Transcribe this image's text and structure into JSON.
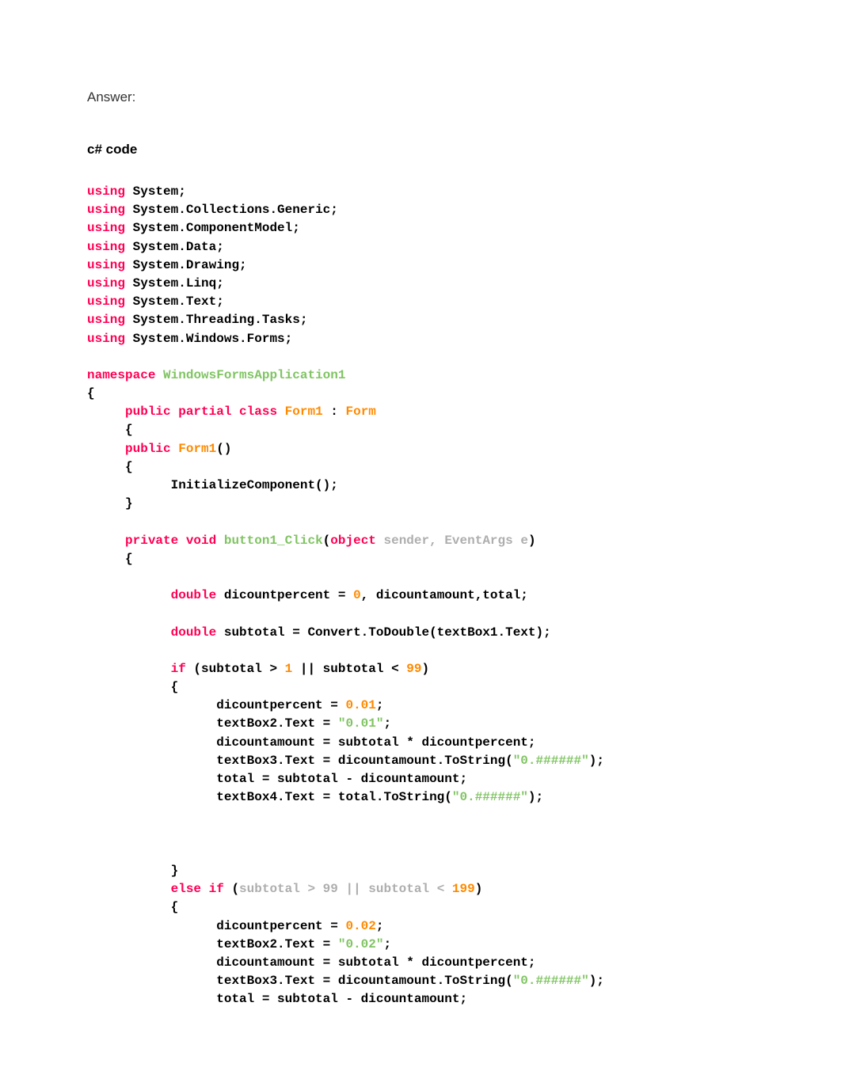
{
  "headings": {
    "answer": "Answer:",
    "section": "c# code"
  },
  "code": {
    "usings": [
      "System",
      "System.Collections.Generic",
      "System.ComponentModel",
      "System.Data",
      "System.Drawing",
      "System.Linq",
      "System.Text",
      "System.Threading.Tasks",
      "System.Windows.Forms"
    ],
    "namespace": "WindowsFormsApplication1",
    "class_name": "Form1",
    "base_class": "Form",
    "ctor": {
      "body": "InitializeComponent();"
    },
    "handler": {
      "name": "button1_Click",
      "params_grey": "sender, EventArgs e",
      "line_decl1_pre": "double dicountpercent = ",
      "line_decl1_zero": "0",
      "line_decl1_post": ", dicountamount,total;",
      "line_subtotal": "double subtotal = Convert.ToDouble(textBox1.Text);",
      "if_cond_pre": "if (subtotal > ",
      "if_cond_n1": "1",
      "if_cond_mid": " || subtotal < ",
      "if_cond_n2": "99",
      "if_cond_post": ")",
      "if1": {
        "l1_pre": "dicountpercent = ",
        "l1_num": "0.01",
        "l1_post": ";",
        "l2_pre": "textBox2.Text = ",
        "l2_str": "\"0.01\"",
        "l2_post": ";",
        "l3": "dicountamount = subtotal * dicountpercent;",
        "l4_pre": "textBox3.Text = dicountamount.ToString(",
        "l4_str": "\"0.######\"",
        "l4_post": ");",
        "l5": "total = subtotal - dicountamount;",
        "l6_pre": "textBox4.Text = total.ToString(",
        "l6_str": "\"0.######\"",
        "l6_post": ");"
      },
      "elseif_cond_pre": "else if (",
      "elseif_cond_grey": "subtotal > 99 || subtotal < ",
      "elseif_cond_n": "199",
      "elseif_cond_post": ")",
      "if2": {
        "l1_pre": "dicountpercent = ",
        "l1_num": "0.02",
        "l1_post": ";",
        "l2_pre": "textBox2.Text = ",
        "l2_str": "\"0.02\"",
        "l2_post": ";",
        "l3": "dicountamount = subtotal * dicountpercent;",
        "l4_pre": "textBox3.Text = dicountamount.ToString(",
        "l4_str": "\"0.######\"",
        "l4_post": ");",
        "l5": "total = subtotal - dicountamount;"
      }
    }
  }
}
